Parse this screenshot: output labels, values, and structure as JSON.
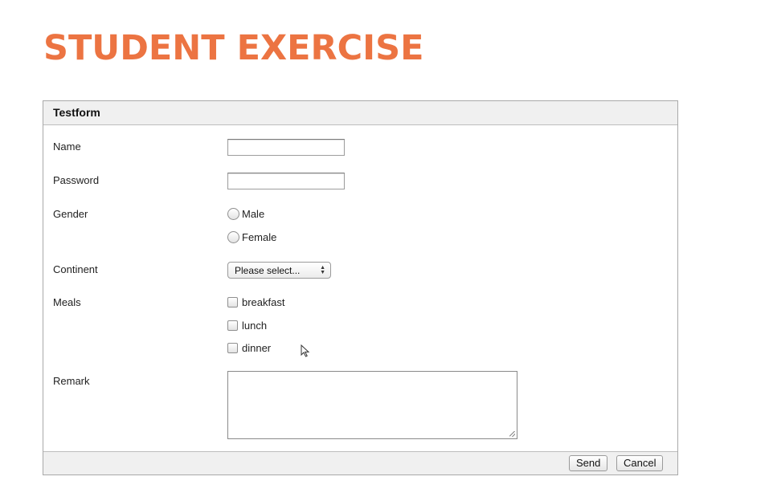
{
  "page": {
    "title": "STUDENT EXERCISE"
  },
  "form": {
    "header": "Testform",
    "fields": {
      "name_label": "Name",
      "password_label": "Password",
      "gender_label": "Gender",
      "continent_label": "Continent",
      "meals_label": "Meals",
      "remark_label": "Remark"
    },
    "gender_options": [
      "Male",
      "Female"
    ],
    "continent_select": {
      "selected": "Please select..."
    },
    "meal_options": [
      "breakfast",
      "lunch",
      "dinner"
    ],
    "buttons": {
      "send": "Send",
      "cancel": "Cancel"
    }
  },
  "colors": {
    "title": "#ec7442",
    "header_bg": "#f0f0f0",
    "border": "#a9a9a9"
  },
  "icons": {
    "select_arrows": "up-down-arrows-icon",
    "cursor": "mouse-pointer-icon",
    "resize": "resize-grip-icon"
  }
}
